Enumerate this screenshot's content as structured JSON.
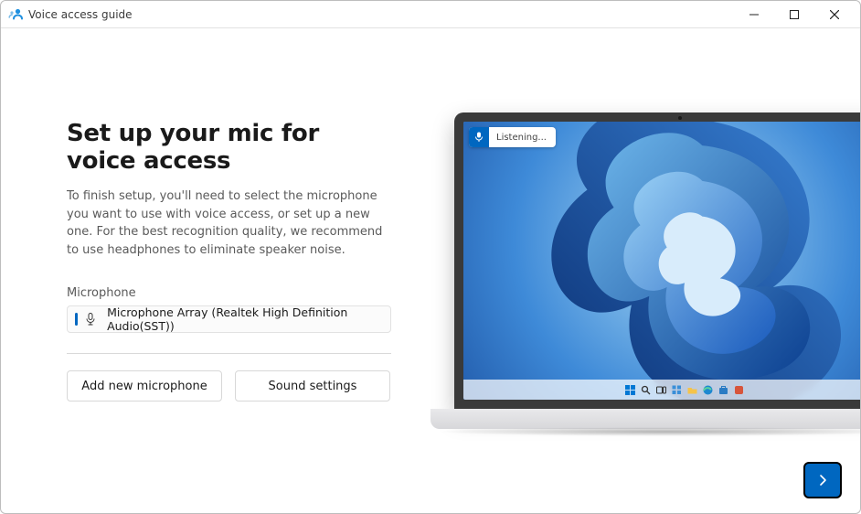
{
  "window": {
    "title": "Voice access guide"
  },
  "page": {
    "heading": "Set up your mic for voice access",
    "description": "To finish setup, you'll need to select the microphone you want to use with voice access, or set up a new one. For the best recognition quality, we recommend to use headphones to eliminate speaker noise.",
    "mic_label": "Microphone",
    "selected_mic": "Microphone Array (Realtek High Definition Audio(SST))",
    "add_mic_label": "Add new microphone",
    "sound_settings_label": "Sound settings"
  },
  "preview": {
    "pill_status": "Listening..."
  },
  "colors": {
    "accent": "#0067c0"
  }
}
